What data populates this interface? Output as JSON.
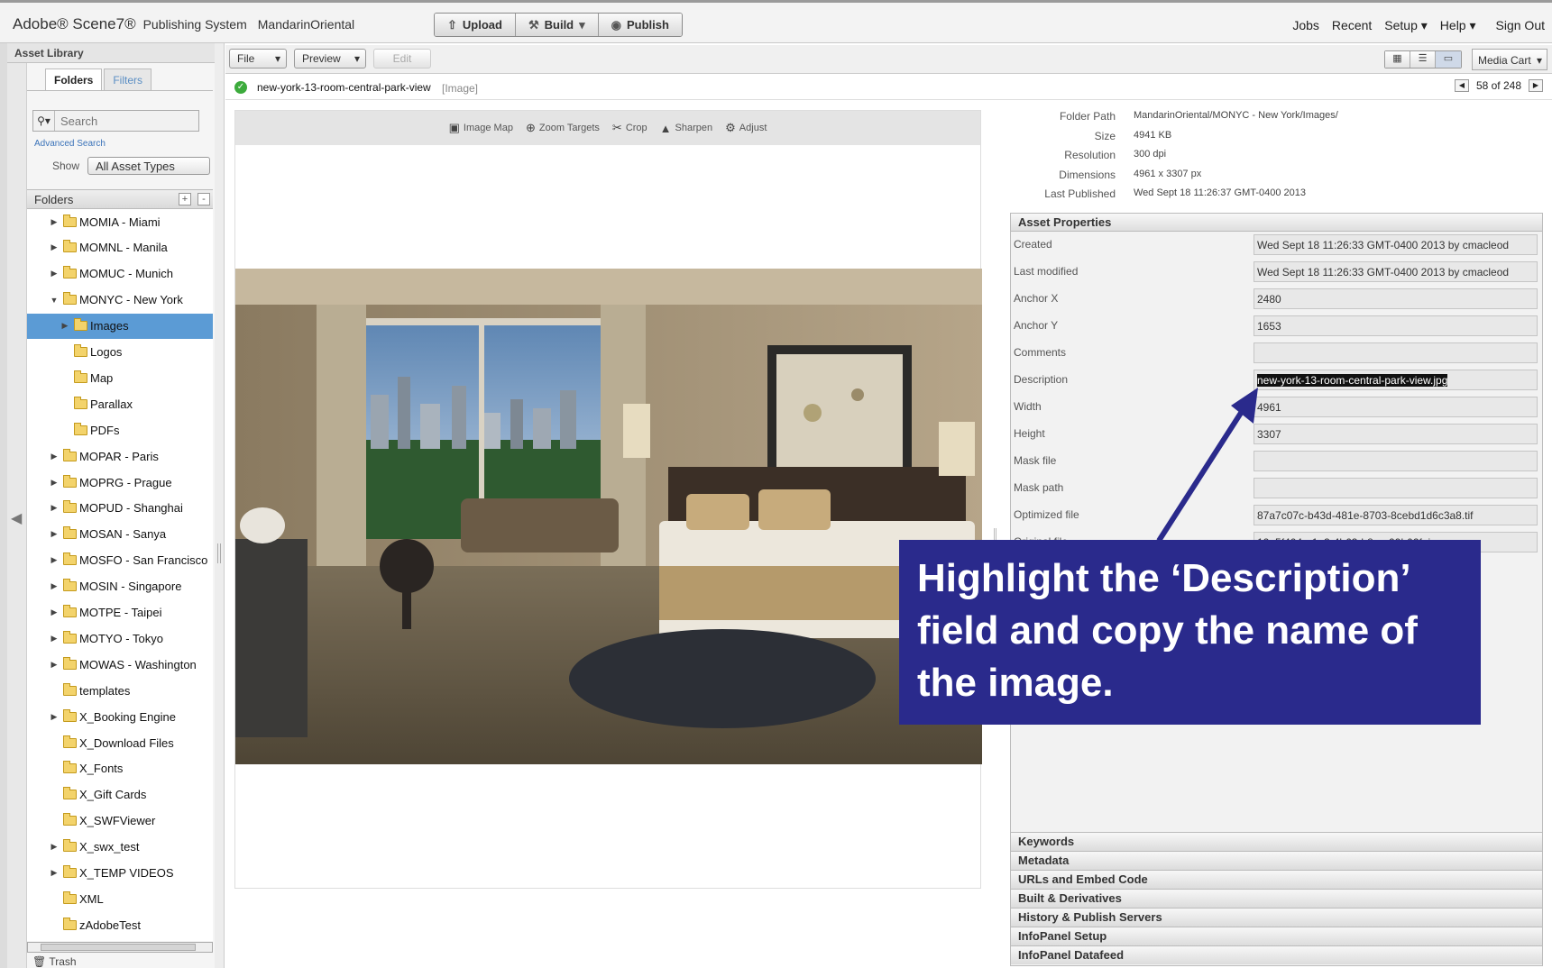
{
  "app": {
    "brand": "Adobe® Scene7®",
    "subtitle": "Publishing System",
    "company": "MandarinOriental",
    "main_buttons": [
      "Upload",
      "Build",
      "Publish"
    ],
    "top_links": [
      "Jobs",
      "Recent",
      "Setup ▾",
      "Help ▾",
      "Sign Out"
    ]
  },
  "library": {
    "title": "Asset Library",
    "tabs": [
      "Folders",
      "Filters"
    ],
    "search_placeholder": "Search",
    "advanced_search": "Advanced Search",
    "show_label": "Show",
    "show_value": "All Asset Types",
    "folders_label": "Folders",
    "tree": [
      {
        "label": "MOMIA - Miami",
        "toggle": "▶",
        "indent": 0
      },
      {
        "label": "MOMNL - Manila",
        "toggle": "▶",
        "indent": 0
      },
      {
        "label": "MOMUC - Munich",
        "toggle": "▶",
        "indent": 0
      },
      {
        "label": "MONYC - New York",
        "toggle": "▼",
        "indent": 0
      },
      {
        "label": "Images",
        "toggle": "▶",
        "indent": 1,
        "selected": true
      },
      {
        "label": "Logos",
        "toggle": "",
        "indent": 1
      },
      {
        "label": "Map",
        "toggle": "",
        "indent": 1
      },
      {
        "label": "Parallax",
        "toggle": "",
        "indent": 1
      },
      {
        "label": "PDFs",
        "toggle": "",
        "indent": 1
      },
      {
        "label": "MOPAR - Paris",
        "toggle": "▶",
        "indent": 0
      },
      {
        "label": "MOPRG - Prague",
        "toggle": "▶",
        "indent": 0
      },
      {
        "label": "MOPUD - Shanghai",
        "toggle": "▶",
        "indent": 0
      },
      {
        "label": "MOSAN - Sanya",
        "toggle": "▶",
        "indent": 0
      },
      {
        "label": "MOSFO - San Francisco",
        "toggle": "▶",
        "indent": 0
      },
      {
        "label": "MOSIN - Singapore",
        "toggle": "▶",
        "indent": 0
      },
      {
        "label": "MOTPE - Taipei",
        "toggle": "▶",
        "indent": 0
      },
      {
        "label": "MOTYO - Tokyo",
        "toggle": "▶",
        "indent": 0
      },
      {
        "label": "MOWAS - Washington",
        "toggle": "▶",
        "indent": 0
      },
      {
        "label": "templates",
        "toggle": "",
        "indent": 0
      },
      {
        "label": "X_Booking Engine",
        "toggle": "▶",
        "indent": 0
      },
      {
        "label": "X_Download Files",
        "toggle": "",
        "indent": 0
      },
      {
        "label": "X_Fonts",
        "toggle": "",
        "indent": 0
      },
      {
        "label": "X_Gift Cards",
        "toggle": "",
        "indent": 0
      },
      {
        "label": "X_SWFViewer",
        "toggle": "",
        "indent": 0
      },
      {
        "label": "X_swx_test",
        "toggle": "▶",
        "indent": 0
      },
      {
        "label": "X_TEMP VIDEOS",
        "toggle": "▶",
        "indent": 0
      },
      {
        "label": "XML",
        "toggle": "",
        "indent": 0
      },
      {
        "label": "zAdobeTest",
        "toggle": "",
        "indent": 0
      }
    ],
    "trash": "Trash"
  },
  "toolbar": {
    "file": "File",
    "preview": "Preview",
    "edit": "Edit",
    "media_cart": "Media Cart"
  },
  "asset": {
    "name": "new-york-13-room-central-park-view",
    "type": "[Image]",
    "pager": "58 of 248"
  },
  "preview_tools": [
    {
      "icon": "image-map-icon",
      "glyph": "▣",
      "label": "Image Map"
    },
    {
      "icon": "zoom-targets-icon",
      "glyph": "⊕",
      "label": "Zoom Targets"
    },
    {
      "icon": "crop-icon",
      "glyph": "✂",
      "label": "Crop"
    },
    {
      "icon": "sharpen-icon",
      "glyph": "▲",
      "label": "Sharpen"
    },
    {
      "icon": "adjust-icon",
      "glyph": "⚙",
      "label": "Adjust"
    }
  ],
  "info": [
    {
      "label": "Folder Path",
      "value": "MandarinOriental/MONYC - New York/Images/"
    },
    {
      "label": "Size",
      "value": "4941 KB"
    },
    {
      "label": "Resolution",
      "value": "300 dpi"
    },
    {
      "label": "Dimensions",
      "value": "4961 x 3307 px"
    },
    {
      "label": "Last Published",
      "value": "Wed  Sept 18 11:26:37 GMT-0400 2013"
    }
  ],
  "asset_properties": {
    "title": "Asset Properties",
    "fields": [
      {
        "label": "Created",
        "value": "Wed  Sept 18 11:26:33 GMT-0400 2013 by cmacleod"
      },
      {
        "label": "Last modified",
        "value": "Wed  Sept 18 11:26:33 GMT-0400 2013 by cmacleod"
      },
      {
        "label": "Anchor X",
        "value": "2480"
      },
      {
        "label": "Anchor Y",
        "value": "1653"
      },
      {
        "label": "Comments",
        "value": ""
      },
      {
        "label": "Description",
        "value": "new-york-13-room-central-park-view.jpg",
        "highlighted": true
      },
      {
        "label": "Width",
        "value": "4961"
      },
      {
        "label": "Height",
        "value": "3307"
      },
      {
        "label": "Mask file",
        "value": ""
      },
      {
        "label": "Mask path",
        "value": ""
      },
      {
        "label": "Optimized file",
        "value": "87a7c07c-b43d-481e-8703-8cebd1d6c3a8.tif"
      },
      {
        "label": "Original file",
        "value": "12e5f404-a1e3-4b63-b8ee-99b02f..jpg"
      }
    ]
  },
  "sections": [
    "Keywords",
    "Metadata",
    "URLs and Embed Code",
    "Built & Derivatives",
    "History & Publish Servers",
    "InfoPanel Setup",
    "InfoPanel Datafeed"
  ],
  "callout": {
    "text": "Highlight the ‘Description’ field and copy the name of the image."
  },
  "colors": {
    "callout_bg": "#2a2a8c",
    "selected_row": "#5b9bd5"
  }
}
